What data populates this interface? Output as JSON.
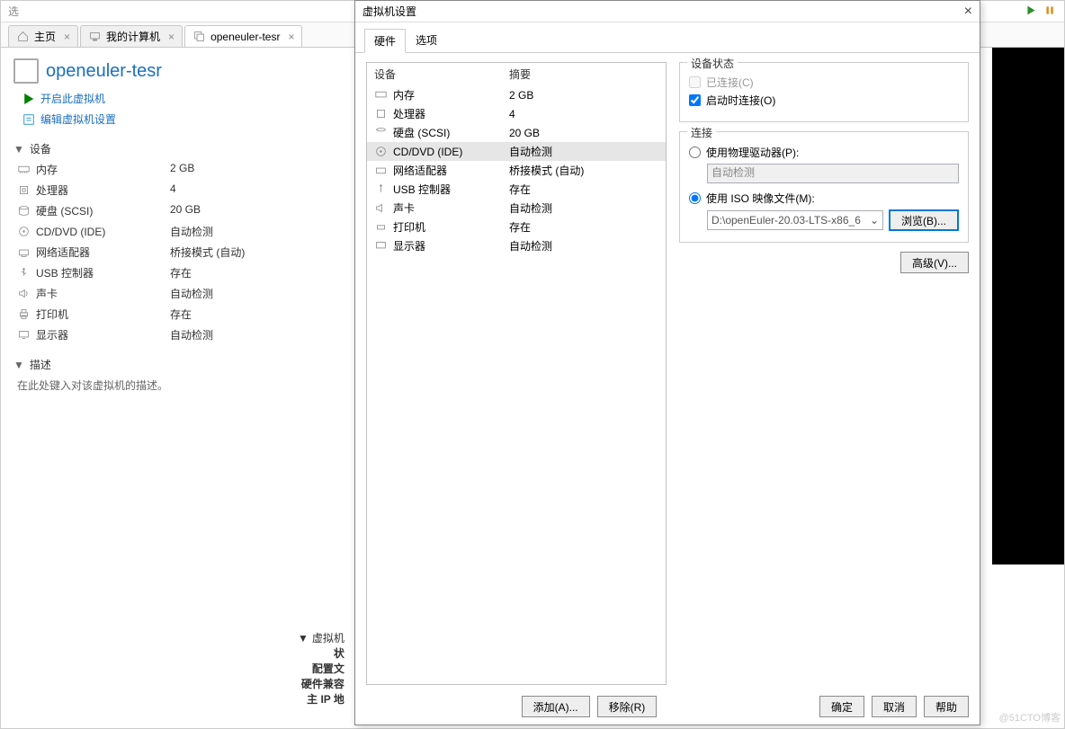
{
  "toolbar": {
    "partial": "选"
  },
  "tabs": {
    "home": "主页",
    "mycomputer": "我的计算机",
    "vm": "openeuler-tesr"
  },
  "vm": {
    "title": "openeuler-tesr",
    "poweron": "开启此虚拟机",
    "editsettings": "编辑虚拟机设置"
  },
  "sections": {
    "devices": "设备",
    "description": "描述"
  },
  "devlist": {
    "memory": {
      "k": "内存",
      "v": "2 GB"
    },
    "cpu": {
      "k": "处理器",
      "v": "4"
    },
    "disk": {
      "k": "硬盘 (SCSI)",
      "v": "20 GB"
    },
    "cd": {
      "k": "CD/DVD (IDE)",
      "v": "自动检测"
    },
    "net": {
      "k": "网络适配器",
      "v": "桥接模式 (自动)"
    },
    "usb": {
      "k": "USB 控制器",
      "v": "存在"
    },
    "sound": {
      "k": "声卡",
      "v": "自动检测"
    },
    "printer": {
      "k": "打印机",
      "v": "存在"
    },
    "display": {
      "k": "显示器",
      "v": "自动检测"
    }
  },
  "desc_placeholder": "在此处键入对该虚拟机的描述。",
  "details": {
    "header": "虚拟机",
    "state": "状",
    "cfg": "配置文",
    "compat": "硬件兼容",
    "ip": "主 IP 地"
  },
  "dialog": {
    "title": "虚拟机设置",
    "tab_hw": "硬件",
    "tab_opt": "选项",
    "col_device": "设备",
    "col_summary": "摘要",
    "rows": {
      "memory": {
        "k": "内存",
        "v": "2 GB"
      },
      "cpu": {
        "k": "处理器",
        "v": "4"
      },
      "disk": {
        "k": "硬盘 (SCSI)",
        "v": "20 GB"
      },
      "cd": {
        "k": "CD/DVD (IDE)",
        "v": "自动检测"
      },
      "net": {
        "k": "网络适配器",
        "v": "桥接模式 (自动)"
      },
      "usb": {
        "k": "USB 控制器",
        "v": "存在"
      },
      "sound": {
        "k": "声卡",
        "v": "自动检测"
      },
      "printer": {
        "k": "打印机",
        "v": "存在"
      },
      "display": {
        "k": "显示器",
        "v": "自动检测"
      }
    },
    "grp_status": "设备状态",
    "chk_connected": "已连接(C)",
    "chk_onstart": "启动时连接(O)",
    "grp_connection": "连接",
    "radio_physical": "使用物理驱动器(P):",
    "auto_detect": "自动检测",
    "radio_iso": "使用 ISO 映像文件(M):",
    "iso_path": "D:\\openEuler-20.03-LTS-x86_6",
    "browse": "浏览(B)...",
    "advanced": "高级(V)...",
    "add": "添加(A)...",
    "remove": "移除(R)",
    "ok": "确定",
    "cancel": "取消",
    "help": "帮助"
  },
  "watermark": "@51CTO博客"
}
